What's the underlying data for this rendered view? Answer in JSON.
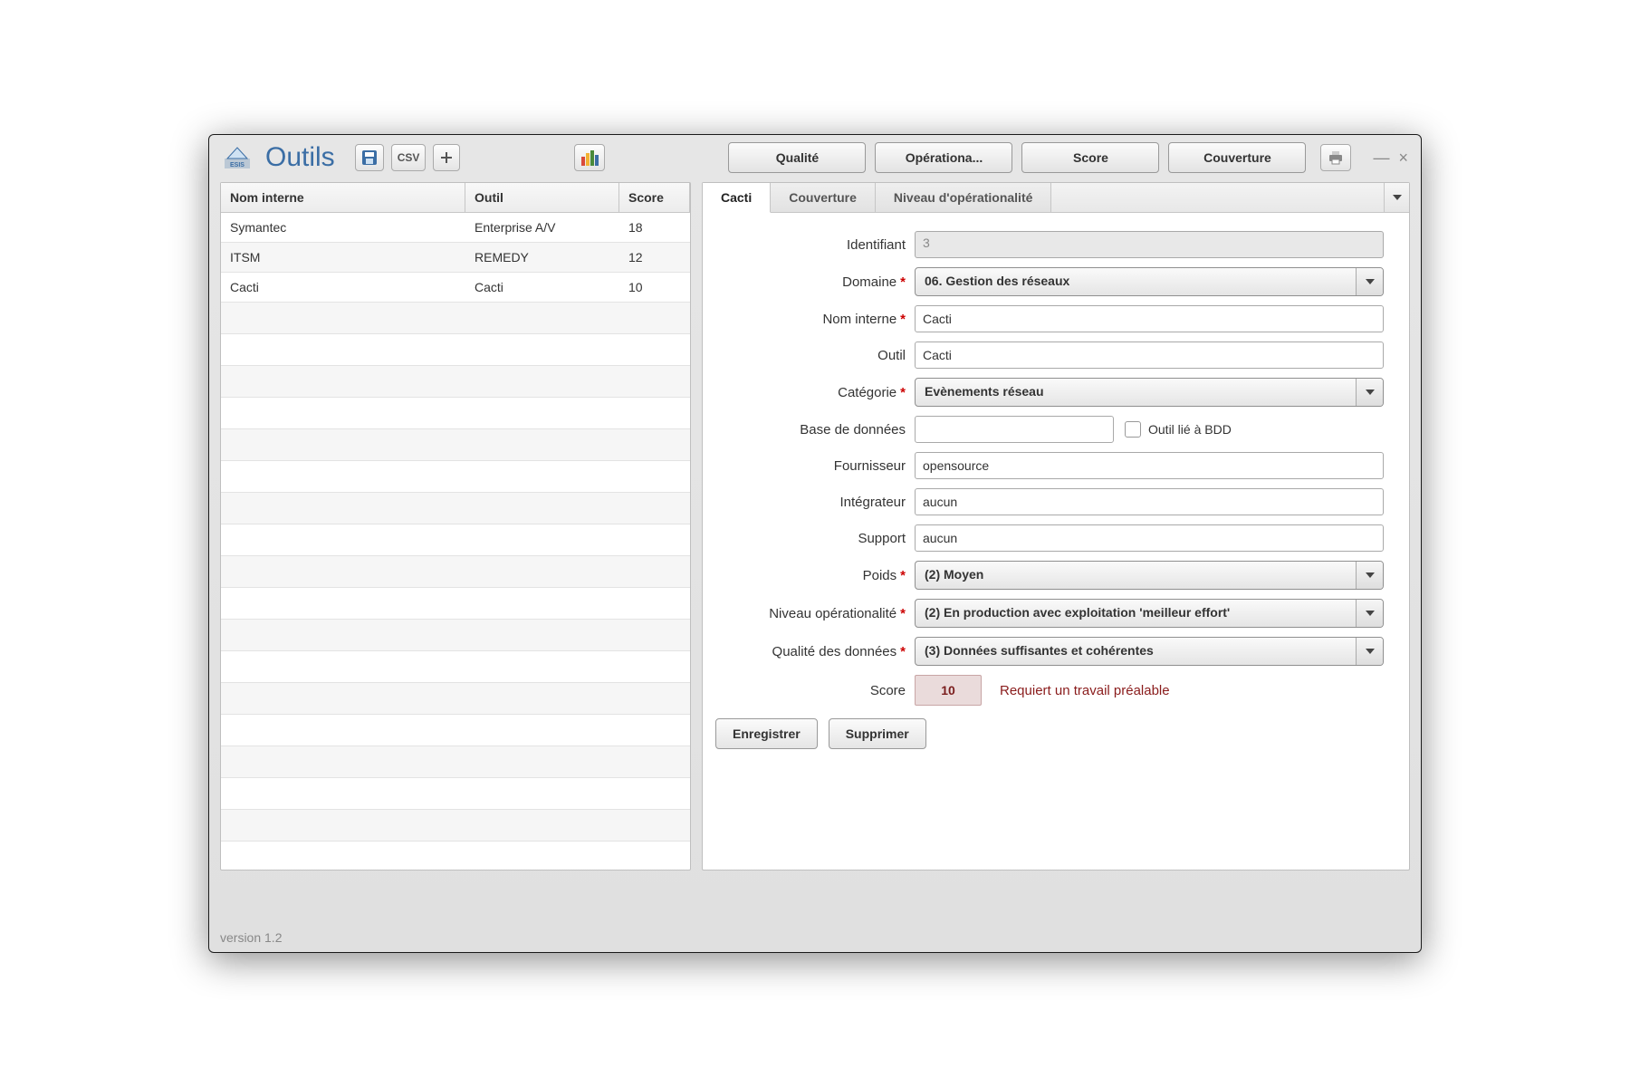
{
  "app": {
    "title": "Outils",
    "version_label": "version 1.2"
  },
  "toolbar": {
    "csv_label": "CSV",
    "tabs": {
      "qualite": "Qualité",
      "operationalite": "Opérationa...",
      "score": "Score",
      "couverture": "Couverture"
    }
  },
  "table": {
    "columns": {
      "nom": "Nom interne",
      "outil": "Outil",
      "score": "Score"
    },
    "rows": [
      {
        "nom": "Symantec",
        "outil": "Enterprise A/V",
        "score": "18"
      },
      {
        "nom": "ITSM",
        "outil": "REMEDY",
        "score": "12"
      },
      {
        "nom": "Cacti",
        "outil": "Cacti",
        "score": "10"
      }
    ]
  },
  "detail": {
    "tabs": {
      "cacti": "Cacti",
      "couverture": "Couverture",
      "niveau": "Niveau d'opérationalité"
    },
    "labels": {
      "identifiant": "Identifiant",
      "domaine": "Domaine",
      "nom_interne": "Nom interne",
      "outil": "Outil",
      "categorie": "Catégorie",
      "base_donnees": "Base de données",
      "lie_bdd": "Outil lié à BDD",
      "fournisseur": "Fournisseur",
      "integrateur": "Intégrateur",
      "support": "Support",
      "poids": "Poids",
      "niveau_op": "Niveau opérationalité",
      "qualite_donnees": "Qualité des données",
      "score": "Score"
    },
    "values": {
      "identifiant": "3",
      "domaine": "06. Gestion des réseaux",
      "nom_interne": "Cacti",
      "outil": "Cacti",
      "categorie": "Evènements réseau",
      "base_donnees": "",
      "fournisseur": "opensource",
      "integrateur": "aucun",
      "support": "aucun",
      "poids": "(2) Moyen",
      "niveau_op": "(2) En production avec exploitation 'meilleur effort'",
      "qualite_donnees": "(3) Données suffisantes et cohérentes",
      "score": "10",
      "score_note": "Requiert un travail préalable"
    },
    "buttons": {
      "save": "Enregistrer",
      "delete": "Supprimer"
    }
  }
}
